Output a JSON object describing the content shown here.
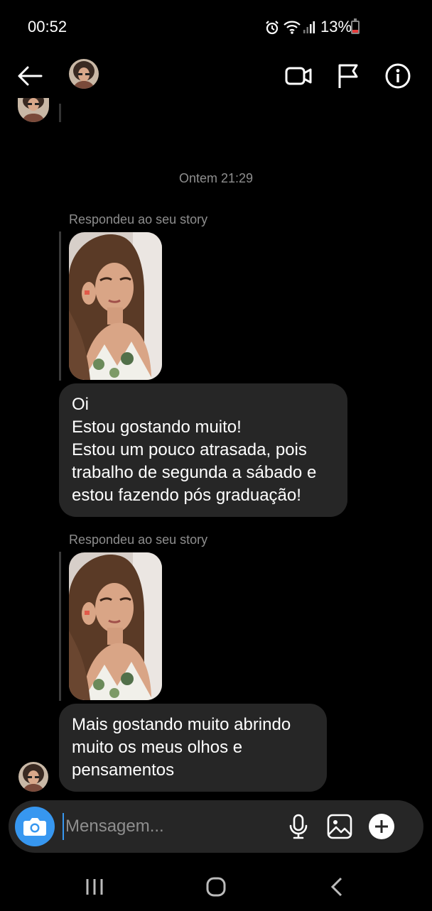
{
  "status_bar": {
    "time": "00:52",
    "battery": "13%",
    "icons": [
      "alarm-icon",
      "wifi-icon",
      "signal-icon",
      "battery-icon"
    ]
  },
  "header": {
    "icons": [
      "back-arrow-icon",
      "video-call-icon",
      "flag-icon",
      "info-icon"
    ]
  },
  "thread": {
    "timestamp": "Ontem 21:29",
    "messages": [
      {
        "reply_label": "Respondeu ao seu story",
        "lines": [
          "Oi",
          "Estou gostando muito!",
          "Estou um pouco atrasada, pois",
          "trabalho de segunda a sábado e",
          "estou fazendo pós graduação!"
        ]
      },
      {
        "reply_label": "Respondeu ao seu story",
        "lines": [
          "Mais gostando muito abrindo",
          "muito os meus olhos e",
          "pensamentos"
        ]
      }
    ]
  },
  "composer": {
    "placeholder": "Mensagem...",
    "icons": [
      "camera-icon",
      "microphone-icon",
      "gallery-icon",
      "plus-icon"
    ]
  },
  "navbar": {
    "icons": [
      "recents-icon",
      "home-icon",
      "back-icon"
    ]
  },
  "colors": {
    "background": "#000000",
    "bubble": "#262626",
    "accent": "#3797f0",
    "muted_text": "#8e8e8e"
  }
}
